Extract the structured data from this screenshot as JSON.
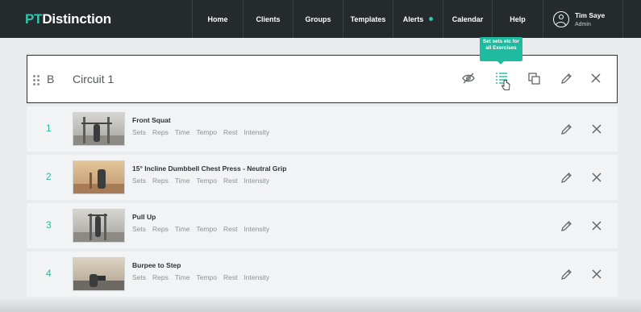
{
  "app": {
    "logo_pt": "PT",
    "logo_rest": "Distinction",
    "brand_color": "#2ec8ad"
  },
  "nav": {
    "items": [
      {
        "label": "Home"
      },
      {
        "label": "Clients"
      },
      {
        "label": "Groups"
      },
      {
        "label": "Templates"
      },
      {
        "label": "Alerts",
        "has_dot": true
      },
      {
        "label": "Calendar"
      },
      {
        "label": "Help"
      }
    ]
  },
  "user": {
    "name": "Tim Saye",
    "role": "Admin",
    "icon": "user-circle-icon"
  },
  "circuit": {
    "letter": "B",
    "title": "Circuit 1",
    "actions": [
      "eye-off-icon",
      "list-settings-icon",
      "copy-icon",
      "pencil-icon",
      "close-icon"
    ],
    "tooltip": "Set sets etc for all Exercises"
  },
  "exercises": [
    {
      "number": "1",
      "name": "Front Squat",
      "meta": [
        "Sets",
        "Reps",
        "Time",
        "Tempo",
        "Rest",
        "Intensity"
      ]
    },
    {
      "number": "2",
      "name": "15° Incline Dumbbell Chest Press - Neutral Grip",
      "meta": [
        "Sets",
        "Reps",
        "Time",
        "Tempo",
        "Rest",
        "Intensity"
      ]
    },
    {
      "number": "3",
      "name": "Pull Up",
      "meta": [
        "Sets",
        "Reps",
        "Time",
        "Tempo",
        "Rest",
        "Intensity"
      ]
    },
    {
      "number": "4",
      "name": "Burpee to Step",
      "meta": [
        "Sets",
        "Reps",
        "Time",
        "Tempo",
        "Rest",
        "Intensity"
      ]
    }
  ]
}
